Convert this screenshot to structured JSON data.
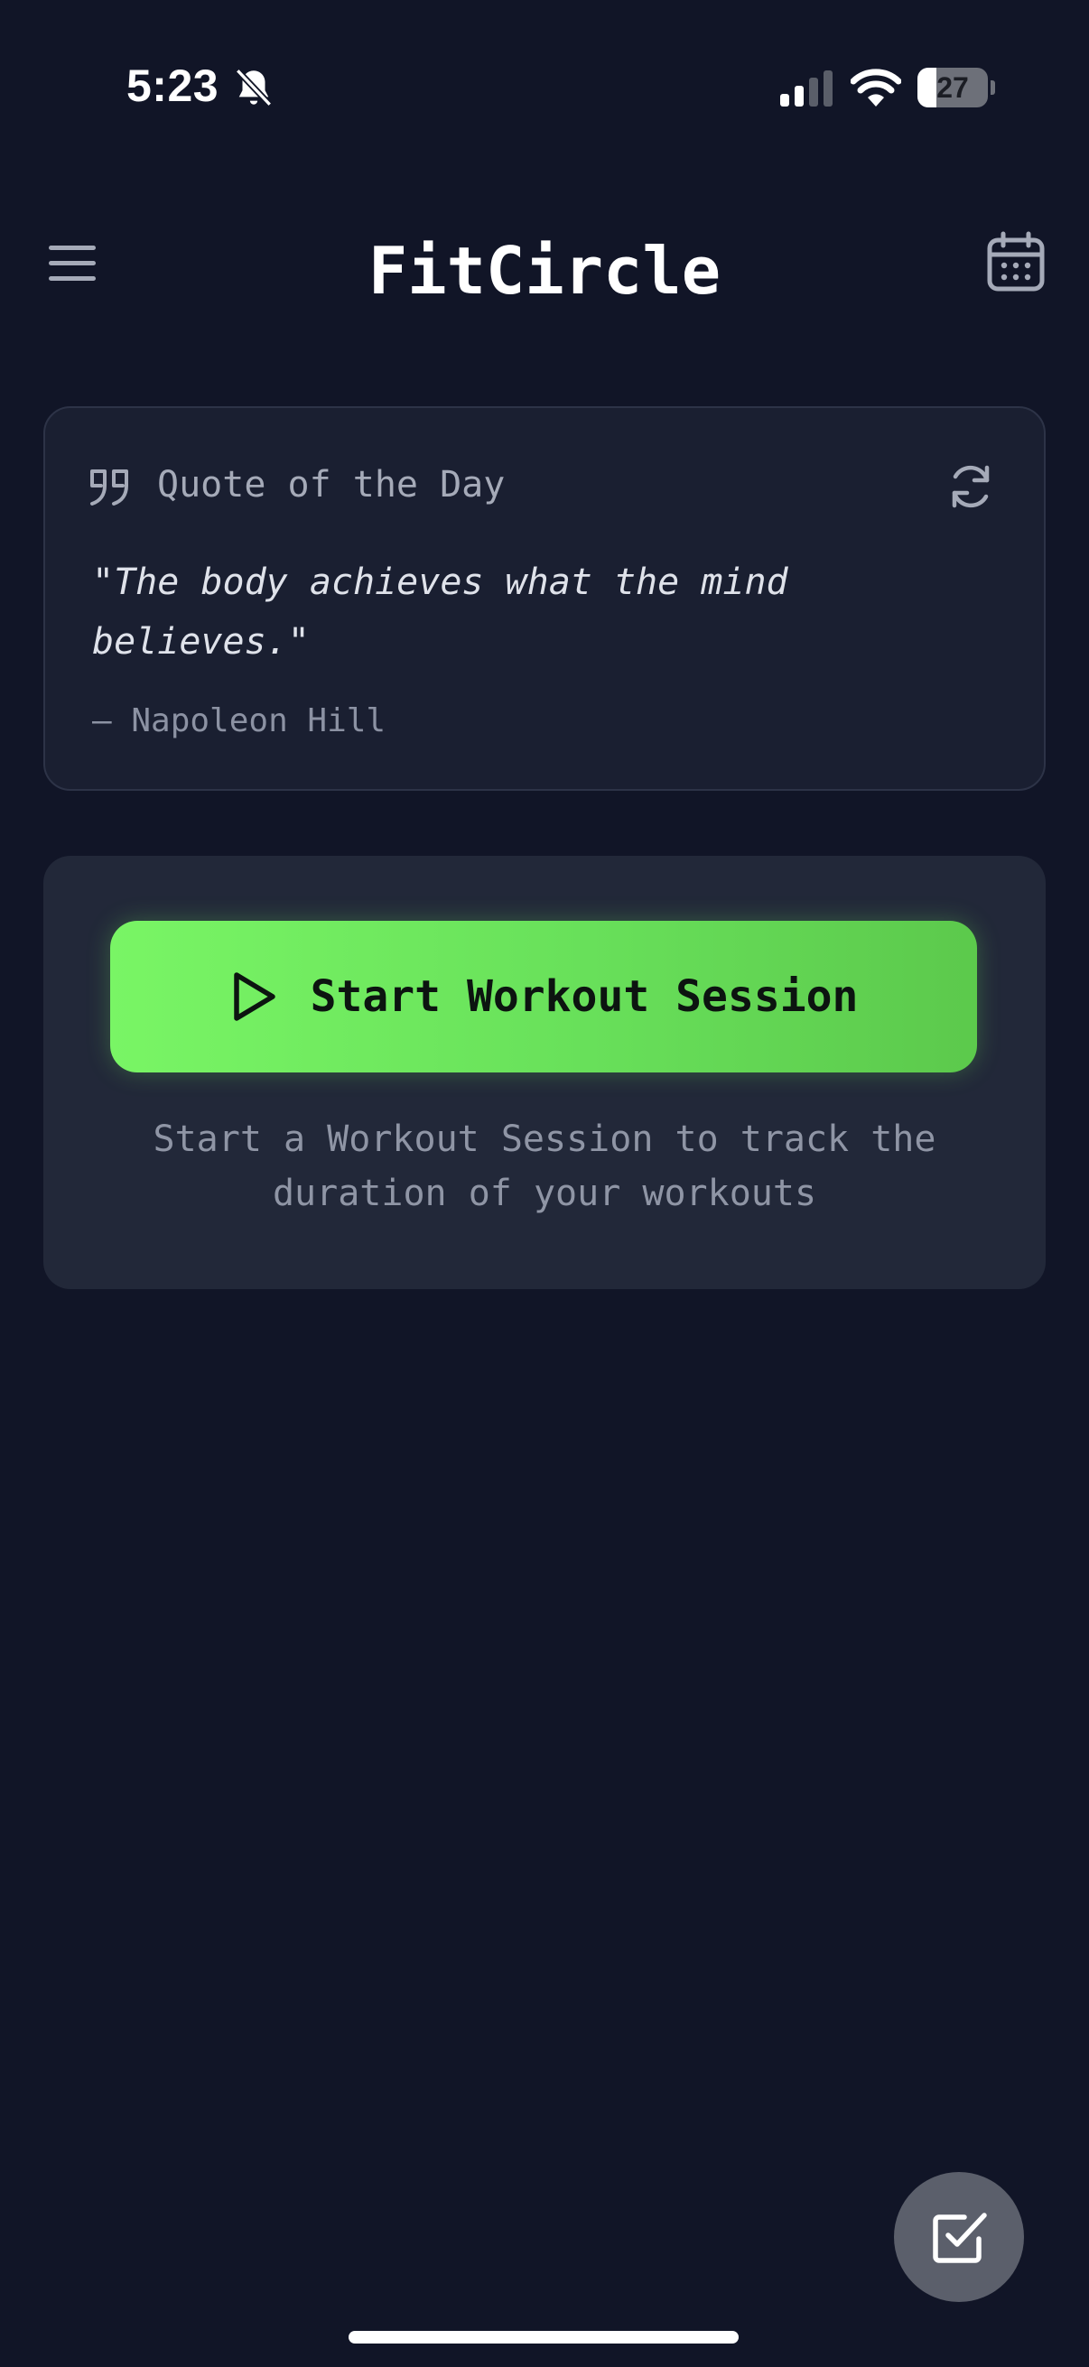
{
  "status_bar": {
    "time": "5:23",
    "battery_level": "27",
    "icons": [
      "bell-off-icon",
      "signal-icon",
      "wifi-icon",
      "battery-icon"
    ]
  },
  "header": {
    "title": "FitCircle",
    "menu_icon": "hamburger-menu-icon",
    "calendar_icon": "calendar-icon"
  },
  "quote_card": {
    "heading": "Quote of the Day",
    "quote": "\"The body achieves what the mind believes.\"",
    "author": "— Napoleon Hill",
    "icons": [
      "quote-icon",
      "refresh-icon"
    ]
  },
  "workout": {
    "button_label": "Start Workout Session",
    "hint": "Start a Workout Session to track the duration of your workouts",
    "icon": "play-icon"
  },
  "fab": {
    "icon": "check-square-icon"
  },
  "colors": {
    "background": "#111527",
    "card": "#1a1f31",
    "workout_card": "#222839",
    "accent_green": "#6fe85d",
    "muted_text": "#8f95a5"
  }
}
